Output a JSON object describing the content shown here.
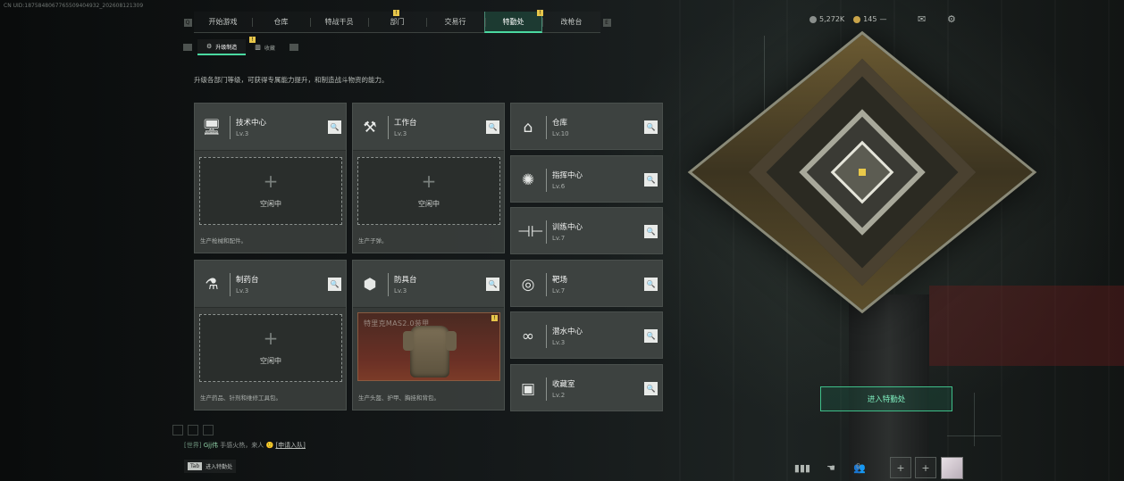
{
  "uid_text": "CN UID:1875848067765509404932_202608121309",
  "nav": {
    "tabs": [
      {
        "label": "开始游戏",
        "badge": false
      },
      {
        "label": "仓库",
        "badge": false
      },
      {
        "label": "特战干员",
        "badge": false
      },
      {
        "label": "部门",
        "badge": true
      },
      {
        "label": "交易行",
        "badge": false
      },
      {
        "label": "特勤处",
        "badge": true,
        "active": true
      },
      {
        "label": "改枪台",
        "badge": false
      }
    ],
    "badge_mark": "!"
  },
  "subnav": {
    "tabs": [
      {
        "label": "升级制造",
        "icon": "gear-icon",
        "active": true,
        "badge": true
      },
      {
        "label": "收藏",
        "icon": "collection-icon",
        "active": false
      }
    ]
  },
  "resources": {
    "currency_1": "5,272K",
    "currency_2": "145"
  },
  "description": "升级各部门等级，可获得专属能力提升，和制造战斗物资的能力。",
  "departments_large": [
    {
      "name": "技术中心",
      "level": "Lv.3",
      "icon": "tech-center-icon",
      "slot_label": "空闲中",
      "footer": "生产枪械和配件。"
    },
    {
      "name": "工作台",
      "level": "Lv.3",
      "icon": "workbench-icon",
      "slot_label": "空闲中",
      "footer": "生产子弹。"
    },
    {
      "name": "制药台",
      "level": "Lv.3",
      "icon": "pharmacy-icon",
      "slot_label": "空闲中",
      "footer": "生产药品、针剂和维修工具包。"
    },
    {
      "name": "防具台",
      "level": "Lv.3",
      "icon": "armor-bench-icon",
      "slot_label": "特里克MAS2.0装甲",
      "footer": "生产头盔、护甲、胸挂和背包。"
    }
  ],
  "departments_small": [
    {
      "name": "仓库",
      "level": "Lv.10",
      "icon": "warehouse-icon"
    },
    {
      "name": "指挥中心",
      "level": "Lv.6",
      "icon": "command-center-icon"
    },
    {
      "name": "训练中心",
      "level": "Lv.7",
      "icon": "training-center-icon"
    },
    {
      "name": "靶场",
      "level": "Lv.7",
      "icon": "target-range-icon"
    },
    {
      "name": "潜水中心",
      "level": "Lv.3",
      "icon": "diving-center-icon"
    },
    {
      "name": "收藏室",
      "level": "Lv.2",
      "icon": "collection-room-icon"
    }
  ],
  "enter_button": "进入特勤处",
  "chat": {
    "channel": "[世界]",
    "sender": "Gjj伟",
    "message": "手感火热，来人",
    "link": "[申请入队]"
  },
  "tab_hint": {
    "key": "Tab",
    "label": "进入特勤处"
  },
  "friend_count": "0",
  "colors": {
    "accent": "#4ad9a0",
    "badge": "#e7c64a",
    "card_bg": "#3d4240"
  }
}
